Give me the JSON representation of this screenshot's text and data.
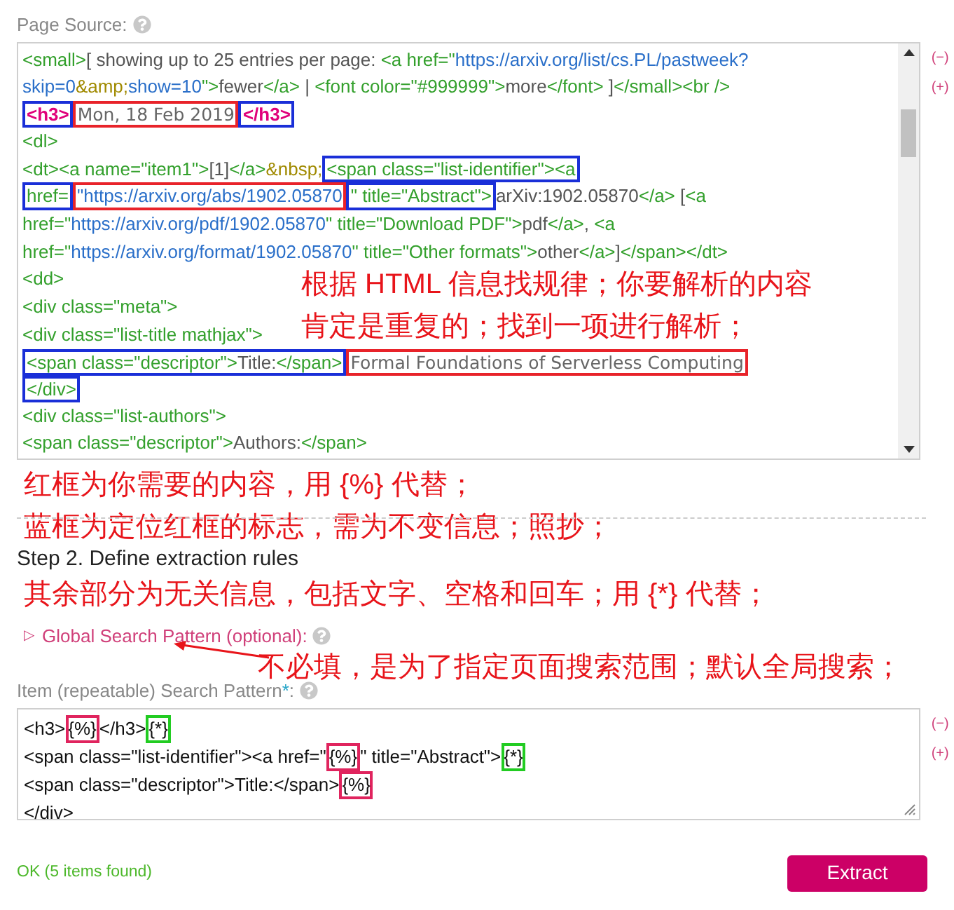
{
  "page_source": {
    "label": "Page Source:",
    "actions": [
      "(−)",
      "(+)"
    ],
    "lines": [
      [
        {
          "segs": [
            {
              "kind": "tag",
              "text": "<small>"
            },
            {
              "kind": "text",
              "text": "[ showing up to 25 entries per page: "
            },
            {
              "kind": "tag",
              "text": "<a href=\""
            },
            {
              "kind": "url",
              "text": "https://arxiv.org/list/cs.PL/pastweek?"
            }
          ]
        }
      ],
      [
        {
          "segs": [
            {
              "kind": "url",
              "text": "skip=0"
            },
            {
              "kind": "entity",
              "text": "&amp;"
            },
            {
              "kind": "url",
              "text": "show=10"
            },
            {
              "kind": "tag",
              "text": "\">"
            },
            {
              "kind": "text",
              "text": "fewer"
            },
            {
              "kind": "tag",
              "text": "</a>"
            },
            {
              "kind": "text",
              "text": " | "
            },
            {
              "kind": "tag",
              "text": "<font color=\"#999999\">"
            },
            {
              "kind": "text",
              "text": "more"
            },
            {
              "kind": "tag",
              "text": "</font>"
            },
            {
              "kind": "text",
              "text": " ]"
            },
            {
              "kind": "tag",
              "text": "</small><br />"
            }
          ]
        }
      ],
      [
        {
          "color": "#1a2fd8",
          "segs": [
            {
              "kind": "h3",
              "text": "<h3>"
            }
          ]
        },
        {
          "color": "#e8232a",
          "segs": [
            {
              "kind": "value",
              "text": "Mon, 18 Feb 2019"
            }
          ]
        },
        {
          "color": "#1a2fd8",
          "segs": [
            {
              "kind": "h3",
              "text": "</h3>"
            }
          ]
        }
      ],
      [
        {
          "segs": [
            {
              "kind": "tag",
              "text": "<dl>"
            }
          ]
        }
      ],
      [
        {
          "segs": [
            {
              "kind": "tag",
              "text": "<dt><a name=\"item1\">"
            },
            {
              "kind": "text",
              "text": "[1]"
            },
            {
              "kind": "tag",
              "text": "</a>"
            },
            {
              "kind": "entity",
              "text": "&nbsp;"
            }
          ]
        },
        {
          "color": "#1a2fd8",
          "segs": [
            {
              "kind": "tag",
              "text": "<span class=\"list-identifier\"><a"
            }
          ]
        }
      ],
      [
        {
          "color": "#1a2fd8",
          "segs": [
            {
              "kind": "tag",
              "text": "href="
            }
          ]
        },
        {
          "color": "#e8232a",
          "segs": [
            {
              "kind": "url",
              "text": "\"https://arxiv.org/abs/1902.05870"
            }
          ]
        },
        {
          "color": "#1a2fd8",
          "segs": [
            {
              "kind": "tag",
              "text": "\" title=\"Abstract\">"
            }
          ]
        },
        {
          "segs": [
            {
              "kind": "text",
              "text": "arXiv:1902.05870"
            },
            {
              "kind": "tag",
              "text": "</a>"
            },
            {
              "kind": "text",
              "text": " ["
            },
            {
              "kind": "tag",
              "text": "<a"
            }
          ]
        }
      ],
      [
        {
          "segs": [
            {
              "kind": "tag",
              "text": "href=\""
            },
            {
              "kind": "url",
              "text": "https://arxiv.org/pdf/1902.05870"
            },
            {
              "kind": "tag",
              "text": "\" title=\"Download PDF\">"
            },
            {
              "kind": "text",
              "text": "pdf"
            },
            {
              "kind": "tag",
              "text": "</a>"
            },
            {
              "kind": "text",
              "text": ", "
            },
            {
              "kind": "tag",
              "text": "<a"
            }
          ]
        }
      ],
      [
        {
          "segs": [
            {
              "kind": "tag",
              "text": "href=\""
            },
            {
              "kind": "url",
              "text": "https://arxiv.org/format/1902.05870"
            },
            {
              "kind": "tag",
              "text": "\" title=\"Other formats\">"
            },
            {
              "kind": "text",
              "text": "other"
            },
            {
              "kind": "tag",
              "text": "</a>"
            },
            {
              "kind": "text",
              "text": "]"
            },
            {
              "kind": "tag",
              "text": "</span></dt>"
            }
          ]
        }
      ],
      [
        {
          "segs": [
            {
              "kind": "tag",
              "text": "<dd>"
            }
          ]
        }
      ],
      [
        {
          "segs": [
            {
              "kind": "tag",
              "text": "<div class=\"meta\">"
            }
          ]
        }
      ],
      [
        {
          "segs": [
            {
              "kind": "tag",
              "text": "<div class=\"list-title mathjax\">"
            }
          ]
        }
      ],
      [
        {
          "color": "#1a2fd8",
          "segs": [
            {
              "kind": "tag",
              "text": "<span class=\"descriptor\">"
            },
            {
              "kind": "text",
              "text": "Title:"
            },
            {
              "kind": "tag",
              "text": "</span>"
            }
          ]
        },
        {
          "color": "#e8232a",
          "segs": [
            {
              "kind": "value",
              "text": "Formal Foundations of Serverless Computing"
            }
          ]
        }
      ],
      [
        {
          "color": "#1a2fd8",
          "segs": [
            {
              "kind": "tag",
              "text": "</div>"
            }
          ]
        }
      ],
      [
        {
          "segs": [
            {
              "kind": "tag",
              "text": "<div class=\"list-authors\">"
            }
          ]
        }
      ],
      [
        {
          "segs": [
            {
              "kind": "tag",
              "text": "<span class=\"descriptor\">"
            },
            {
              "kind": "text",
              "text": "Authors:"
            },
            {
              "kind": "tag",
              "text": "</span>"
            }
          ]
        }
      ]
    ],
    "notes": [
      "根据 HTML 信息找规律；你要解析的内容",
      "肯定是重复的；找到一项进行解析；"
    ]
  },
  "notes": [
    "红框为你需要的内容，用 {%} 代替；",
    "蓝框为定位红框的标志，需为不变信息；照抄；"
  ],
  "step2": {
    "title": "Step 2. Define extraction rules",
    "note": "其余部分为无关信息，包括文字、空格和回车；用 {*} 代替；"
  },
  "global_search": {
    "toggle": "▷",
    "label": "Global Search Pattern (optional):",
    "note": "不必填，是为了指定页面搜索范围；默认全局搜索；"
  },
  "item_pattern": {
    "label": "Item (repeatable) Search Pattern",
    "required": "*",
    "label_end": ":",
    "actions": [
      "(−)",
      "(+)"
    ],
    "lines": [
      [
        {
          "text": "<h3>"
        },
        {
          "color": "#e0245e",
          "text": "{%}"
        },
        {
          "text": "</h3>"
        },
        {
          "color": "#22cc22",
          "text": "{*}"
        }
      ],
      [
        {
          "text": "<span class=\"list-identifier\"><a href=\""
        },
        {
          "color": "#e0245e",
          "text": "{%}"
        },
        {
          "text": "\" title=\"Abstract\">"
        },
        {
          "color": "#22cc22",
          "text": "{*}"
        }
      ],
      [
        {
          "text": "<span class=\"descriptor\">Title:</span>"
        },
        {
          "color": "#e0245e",
          "text": "{%}"
        }
      ],
      [
        {
          "text": "</div>"
        }
      ]
    ]
  },
  "status": "OK (5 items found)",
  "extract_button": "Extract"
}
